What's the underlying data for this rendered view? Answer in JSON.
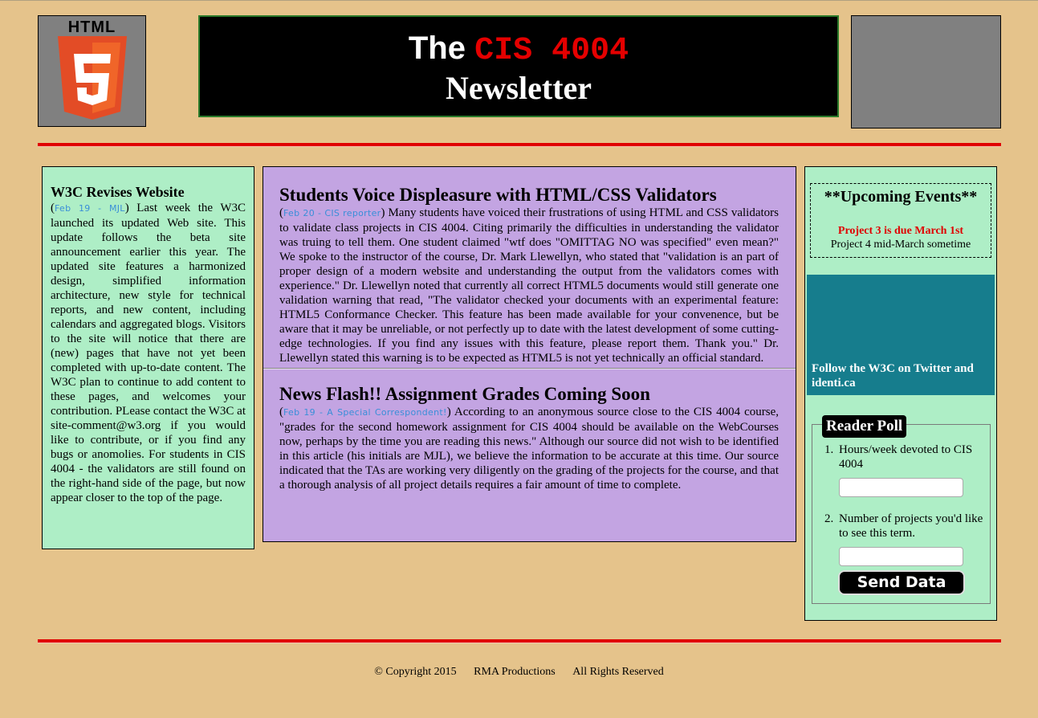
{
  "header": {
    "logo_word": "HTML",
    "title_the": "The",
    "title_course": "CIS 4004",
    "title_newsletter": "Newsletter"
  },
  "left": {
    "headline": "W3C Revises Website",
    "byline": "Feb 19 - MJL",
    "body": "Last week the W3C launched its updated Web site. This update follows the beta site announcement earlier this year. The updated site features a harmonized design, simplified information architecture, new style for technical reports, and new content, including calendars and aggregated blogs. Visitors to the site will notice that there are (new) pages that have not yet been completed with up-to-date content. The W3C plan to continue to add content to these pages, and welcomes your contribution. PLease contact the W3C at site-comment@w3.org if you would like to contribute, or if you find any bugs or anomolies. For students in CIS 4004 - the validators are still found on the right-hand side of the page, but now appear closer to the top of the page."
  },
  "center": {
    "articles": [
      {
        "headline": "Students Voice Displeasure with HTML/CSS Validators",
        "byline": "Feb 20 - CIS reporter",
        "body": "Many students have voiced their frustrations of using HTML and CSS validators to validate class projects in CIS 4004. Citing primarily the difficulties in understanding the validator was truing to tell them. One student claimed \"wtf does \"OMITTAG NO was specified\" even mean?\" We spoke to the instructor of the course, Dr. Mark Llewellyn, who stated that \"validation is an part of proper design of a modern website and understanding the output from the validators comes with experience.\" Dr. Llewellyn noted that currently all correct HTML5 documents would still generate one validation warning that read, \"The validator checked your documents with an experimental feature: HTML5 Conformance Checker. This feature has been made available for your convenence, but be aware that it may be unreliable, or not perfectly up to date with the latest development of some cutting-edge technologies. If you find any issues with this feature, please report them. Thank you.\" Dr. Llewellyn stated this warning is to be expected as HTML5 is not yet technically an official standard."
      },
      {
        "headline": "News Flash!! Assignment Grades Coming Soon",
        "byline": "Feb 19 - A Special Correspondent!",
        "body": "According to an anonymous source close to the CIS 4004 course, \"grades for the second homework assignment for CIS 4004 should be available on the WebCourses now, perhaps by the time you are reading this news.\" Although our source did not wish to be identified in this article (his initials are MJL), we believe the information to be accurate at this time. Our source indicated that the TAs are working very diligently on the grading of the projects for the course, and that a thorough analysis of all project details requires a fair amount of time to complete."
      }
    ]
  },
  "right": {
    "events_title": "**Upcoming Events**",
    "events_highlight": "Project 3 is due March 1st",
    "events_line": "Project 4 mid-March sometime",
    "twitter_text": "Follow the W3C on Twitter and identi.ca",
    "poll": {
      "legend": "Reader Poll",
      "q1_num": "1.",
      "q1": "Hours/week devoted to CIS 4004",
      "q2_num": "2.",
      "q2": "Number of projects you'd like to see this term.",
      "submit_label": "Send Data"
    }
  },
  "footer": {
    "copyright": "© Copyright 2015",
    "company": "RMA Productions",
    "rights": "All Rights Reserved"
  },
  "colors": {
    "page_bg": "#e5c38b",
    "green_panel": "#aeeec6",
    "purple_panel": "#c3a4e2",
    "teal_panel": "#167d8d",
    "rule_red": "#e00000",
    "course_red": "#e50000",
    "byline_blue": "#3a8fd8"
  },
  "icons": {
    "logo": "html5-shield-icon"
  }
}
